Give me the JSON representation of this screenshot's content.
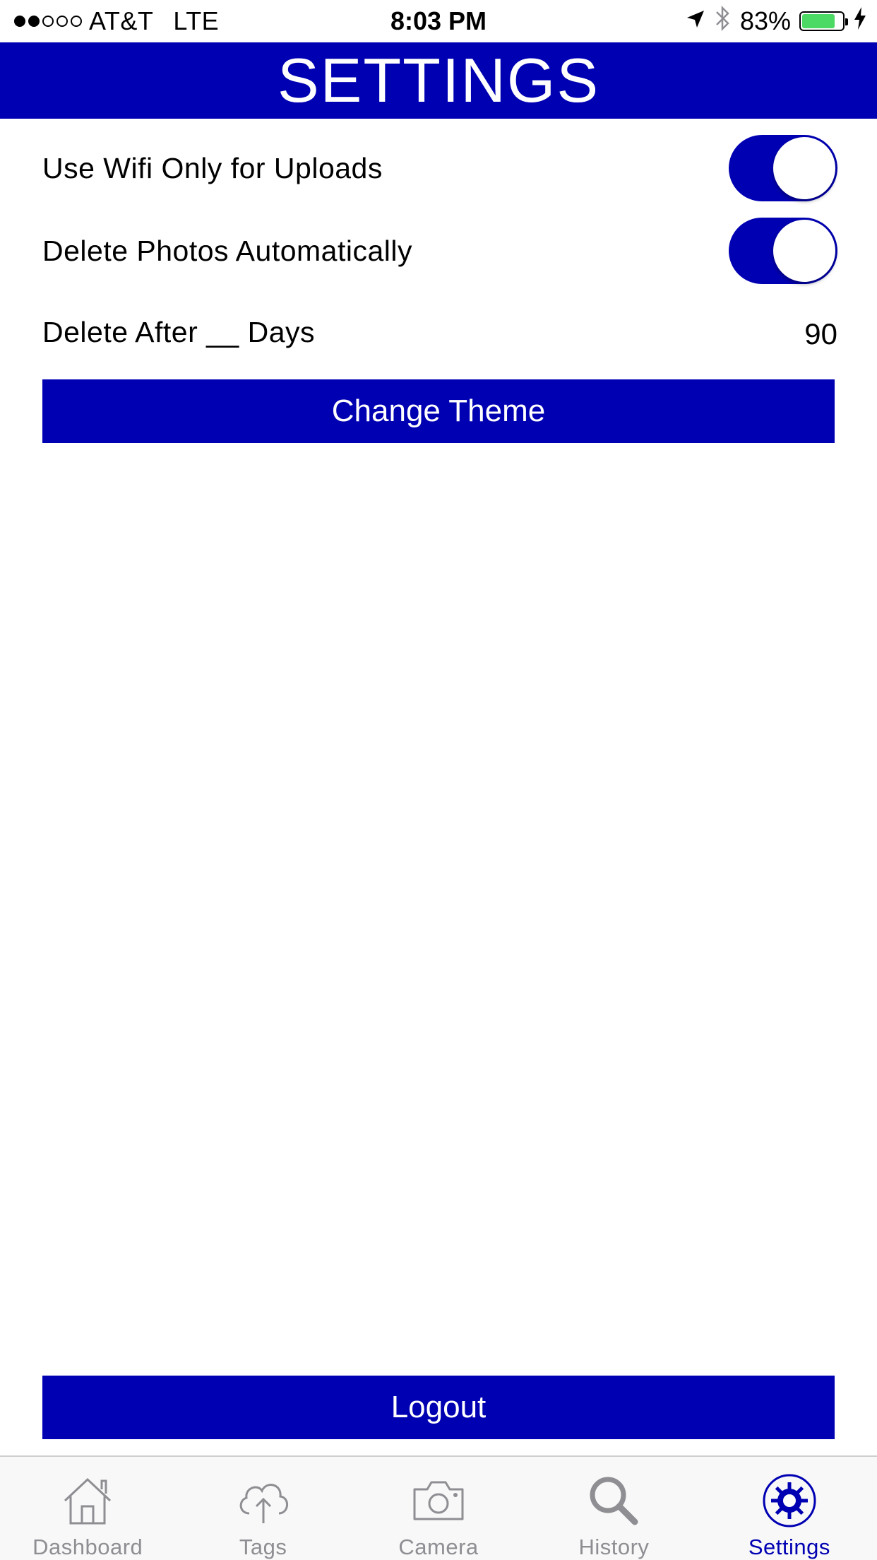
{
  "status_bar": {
    "carrier": "AT&T",
    "network": "LTE",
    "time": "8:03 PM",
    "battery_percent": "83%",
    "battery_level": 0.83,
    "signal_bars_filled": 2,
    "signal_bars_total": 5,
    "icons": [
      "location-arrow-icon",
      "bluetooth-icon",
      "battery-icon",
      "charging-bolt-icon"
    ]
  },
  "header": {
    "title": "SETTINGS"
  },
  "settings": {
    "wifi_only": {
      "label": "Use Wifi Only for Uploads",
      "enabled": true
    },
    "delete_auto": {
      "label": "Delete Photos Automatically",
      "enabled": true
    },
    "delete_after": {
      "label": "Delete After __ Days",
      "value": "90"
    }
  },
  "buttons": {
    "change_theme": "Change Theme",
    "logout": "Logout"
  },
  "tab_bar": {
    "items": [
      {
        "label": "Dashboard",
        "icon": "house-icon",
        "active": false
      },
      {
        "label": "Tags",
        "icon": "cloud-upload-icon",
        "active": false
      },
      {
        "label": "Camera",
        "icon": "camera-icon",
        "active": false
      },
      {
        "label": "History",
        "icon": "magnifier-icon",
        "active": false
      },
      {
        "label": "Settings",
        "icon": "gear-icon",
        "active": true
      }
    ]
  },
  "colors": {
    "accent": "#0000b3",
    "tab_inactive": "#8e8e93",
    "battery_fill": "#4cd964"
  }
}
